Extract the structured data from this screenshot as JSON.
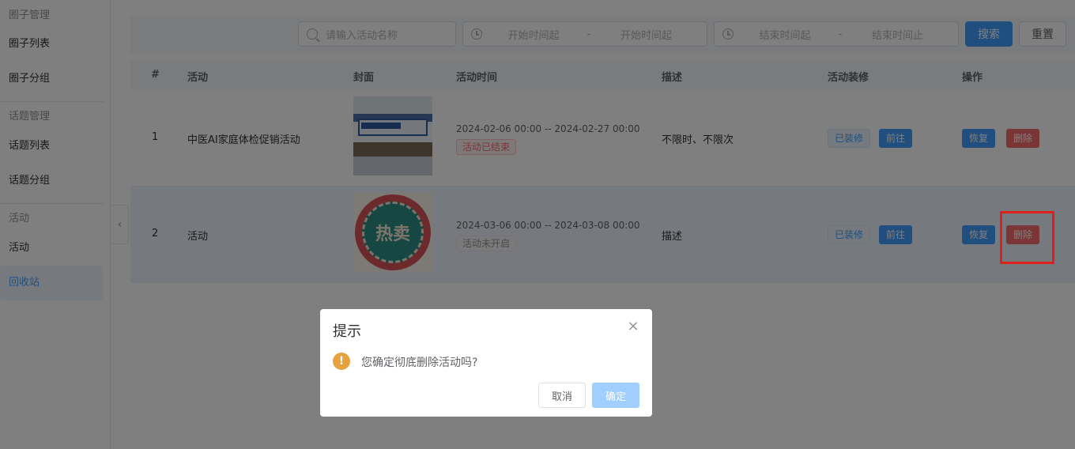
{
  "sidebar": {
    "groups": [
      {
        "title": "圈子管理",
        "items": [
          "圈子列表",
          "圈子分组"
        ]
      },
      {
        "title": "话题管理",
        "items": [
          "话题列表",
          "话题分组"
        ]
      },
      {
        "title": "活动",
        "items": [
          "活动",
          "回收站"
        ]
      }
    ],
    "active_item": "回收站",
    "collapse_icon": "chevron-left-icon"
  },
  "filters": {
    "search_placeholder": "请输入活动名称",
    "start_range": {
      "from": "开始时间起",
      "sep": "-",
      "to": "开始时间起"
    },
    "end_range": {
      "from": "结束时间起",
      "sep": "-",
      "to": "结束时间止"
    },
    "search_button": "搜索",
    "reset_button": "重置"
  },
  "table": {
    "headers": [
      "#",
      "活动",
      "封面",
      "活动时间",
      "描述",
      "活动装修",
      "操作"
    ],
    "rows": [
      {
        "index": "1",
        "name": "中医AI家庭体检促销活动",
        "time": "2024-02-06 00:00 -- 2024-02-27 00:00",
        "status": "活动已结束",
        "description": "不限时、不限次",
        "decor_tag": "已装修",
        "goto_button": "前往",
        "restore_button": "恢复",
        "delete_button": "删除"
      },
      {
        "index": "2",
        "name": "活动",
        "time": "2024-03-06 00:00 -- 2024-03-08 00:00",
        "status": "活动未开启",
        "description": "描述",
        "decor_tag": "已装修",
        "goto_button": "前往",
        "restore_button": "恢复",
        "delete_button": "删除",
        "cover_text": "热卖"
      }
    ]
  },
  "dialog": {
    "title": "提示",
    "message": "您确定彻底删除活动吗?",
    "cancel": "取消",
    "confirm": "确定",
    "icon": "warning-icon"
  },
  "colors": {
    "primary": "#409eff",
    "danger": "#f56c6c",
    "warning": "#e6a23c",
    "highlight": "#e0201d"
  }
}
